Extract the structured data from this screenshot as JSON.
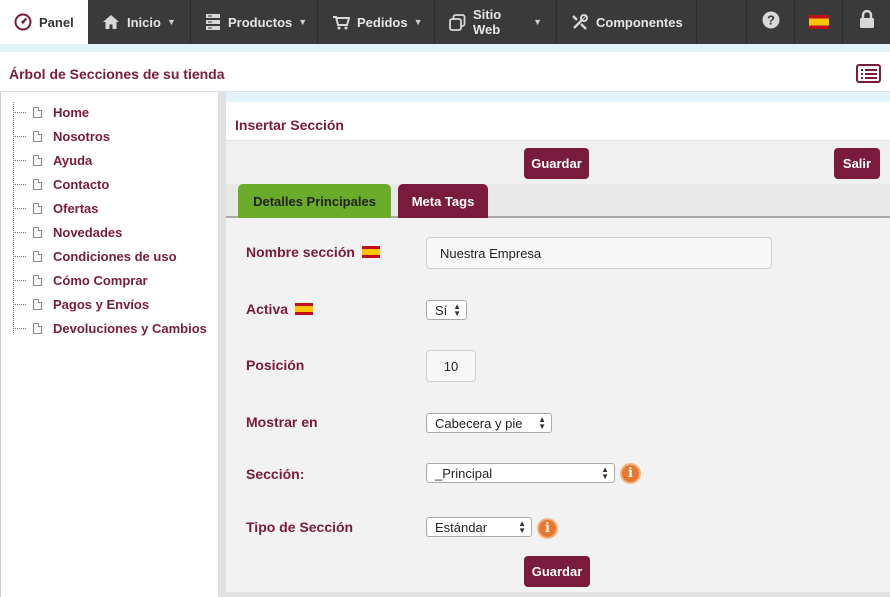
{
  "nav": {
    "panel": "Panel",
    "items": [
      {
        "label": "Inicio",
        "icon": "home-icon"
      },
      {
        "label": "Productos",
        "icon": "products-icon"
      },
      {
        "label": "Pedidos",
        "icon": "cart-icon"
      },
      {
        "label": "Sitio Web",
        "icon": "website-icon"
      },
      {
        "label": "Componentes",
        "icon": "tools-icon"
      }
    ],
    "right_icons": [
      "help-icon",
      "spain-flag-icon",
      "lock-icon"
    ]
  },
  "tree": {
    "title": "Árbol de Secciones de su tienda",
    "items": [
      "Home",
      "Nosotros",
      "Ayuda",
      "Contacto",
      "Ofertas",
      "Novedades",
      "Condiciones de uso",
      "Cómo Comprar",
      "Pagos y Envíos",
      "Devoluciones y Cambios"
    ]
  },
  "form": {
    "title": "Insertar Sección",
    "save_label": "Guardar",
    "exit_label": "Salir",
    "tabs": [
      "Detalles Principales",
      "Meta Tags"
    ],
    "active_tab": "Detalles Principales",
    "fields": {
      "nombre": {
        "label": "Nombre sección",
        "value": "Nuestra Empresa"
      },
      "activa": {
        "label": "Activa",
        "value": "Sí"
      },
      "posicion": {
        "label": "Posición",
        "value": "10"
      },
      "mostrar": {
        "label": "Mostrar en",
        "value": "Cabecera y pie"
      },
      "seccion": {
        "label": "Sección:",
        "value": "_Principal"
      },
      "tipo": {
        "label": "Tipo de Sección",
        "value": "Estándar"
      }
    },
    "bottom_save_label": "Guardar"
  },
  "colors": {
    "brand": "#7a1a3c",
    "active_tab": "#6aac2a",
    "nav_bg": "#3a3a3a",
    "info": "#e8772e"
  }
}
